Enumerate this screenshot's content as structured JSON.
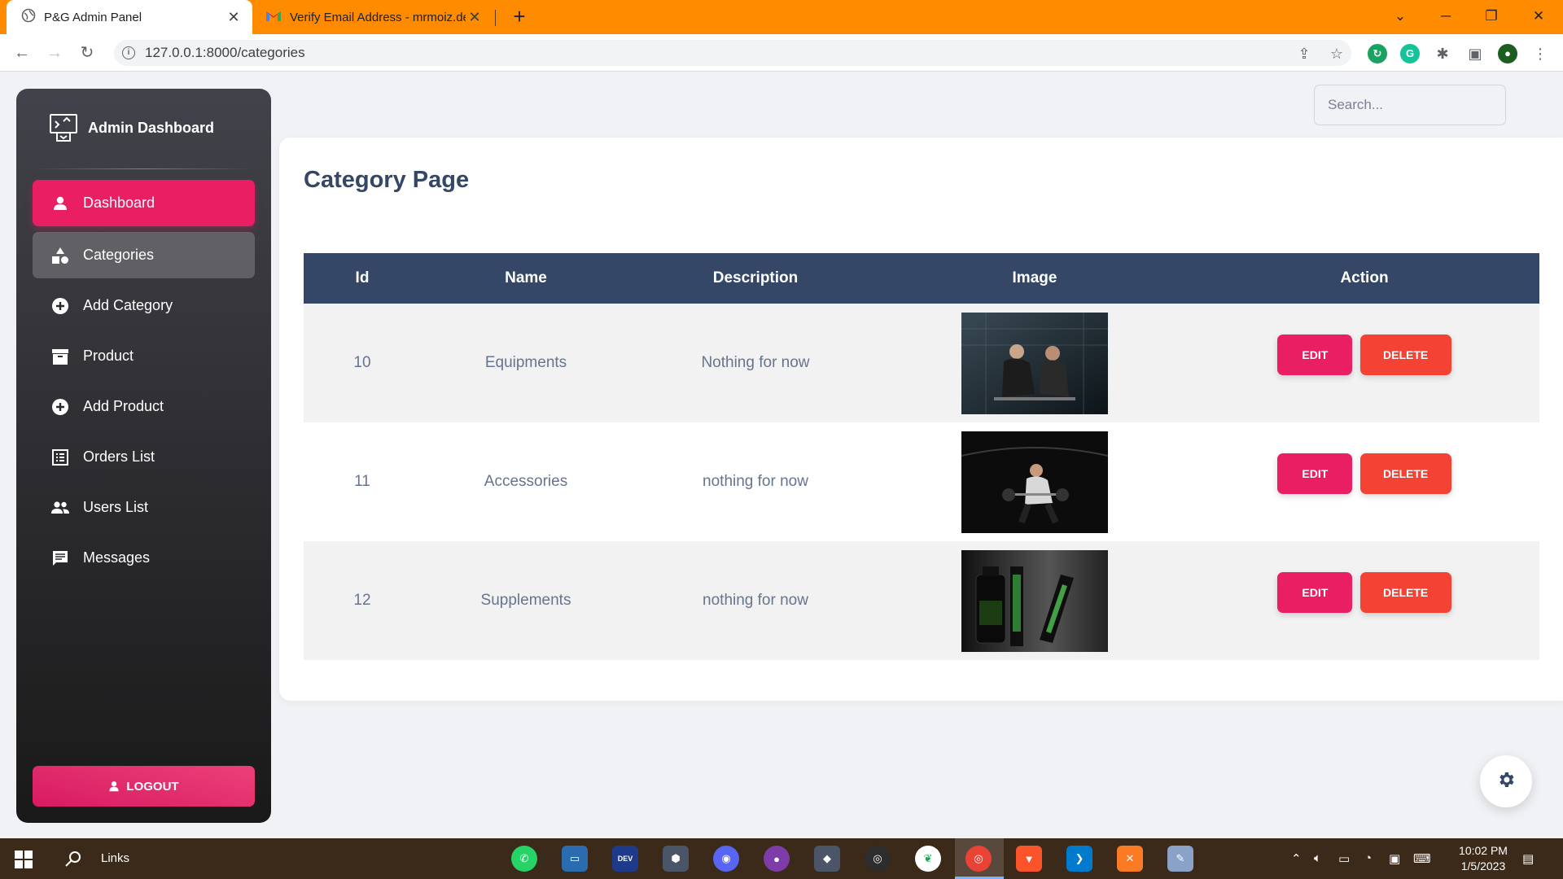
{
  "browser": {
    "tabs": [
      {
        "title": "P&G Admin Panel",
        "active": true
      },
      {
        "title": "Verify Email Address - mrmoiz.de",
        "active": false
      }
    ],
    "url": "127.0.0.1:8000/categories"
  },
  "sidebar": {
    "brand": "Admin Dashboard",
    "items": [
      {
        "label": "Dashboard",
        "icon": "person-icon",
        "state": "active"
      },
      {
        "label": "Categories",
        "icon": "shapes-icon",
        "state": "hover"
      },
      {
        "label": "Add Category",
        "icon": "add-circle-icon",
        "state": "normal"
      },
      {
        "label": "Product",
        "icon": "archive-icon",
        "state": "normal"
      },
      {
        "label": "Add Product",
        "icon": "add-circle-icon",
        "state": "normal"
      },
      {
        "label": "Orders List",
        "icon": "list-alt-icon",
        "state": "normal"
      },
      {
        "label": "Users List",
        "icon": "people-icon",
        "state": "normal"
      },
      {
        "label": "Messages",
        "icon": "chat-icon",
        "state": "normal"
      }
    ],
    "logout_label": "LOGOUT"
  },
  "search": {
    "placeholder": "Search..."
  },
  "main": {
    "title": "Category Page",
    "table": {
      "headers": [
        "Id",
        "Name",
        "Description",
        "Image",
        "Action"
      ],
      "rows": [
        {
          "id": "10",
          "name": "Equipments",
          "description": "Nothing for now",
          "image": "gym-photo"
        },
        {
          "id": "11",
          "name": "Accessories",
          "description": "nothing for now",
          "image": "weightlifter-photo"
        },
        {
          "id": "12",
          "name": "Supplements",
          "description": "nothing for now",
          "image": "protein-photo"
        }
      ],
      "edit_label": "EDIT",
      "delete_label": "DELETE"
    }
  },
  "taskbar": {
    "links_label": "Links",
    "time": "10:02 PM",
    "date": "1/5/2023"
  },
  "colors": {
    "accent": "#e91e63",
    "delete": "#f44335",
    "table_header": "#344767",
    "tab_bar": "#ff8c00"
  }
}
